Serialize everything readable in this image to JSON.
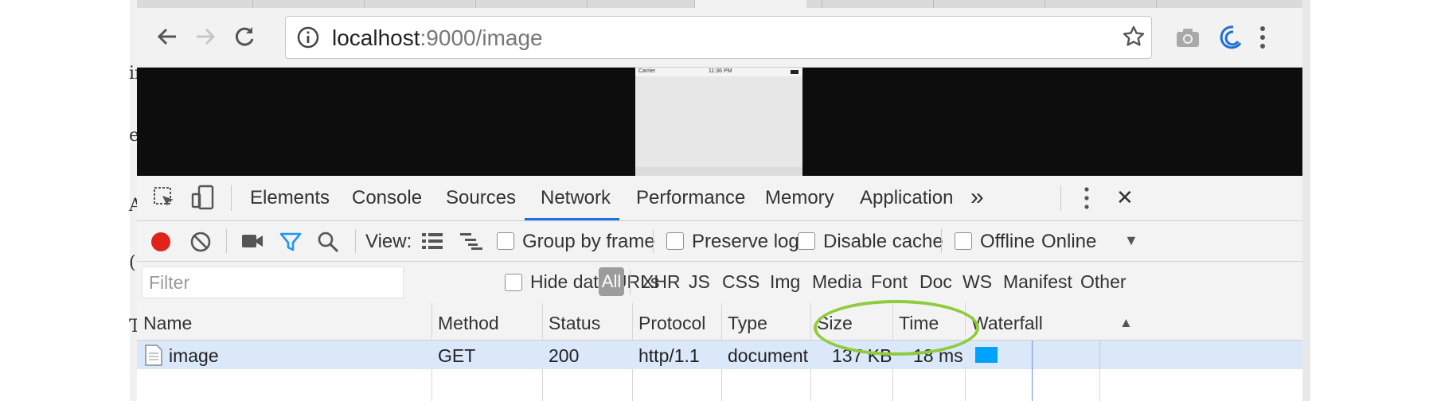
{
  "browser": {
    "url_host": "localhost",
    "url_path": ":9000/image",
    "nav": {
      "back": "back-arrow-icon",
      "forward": "forward-arrow-icon",
      "reload": "reload-icon"
    }
  },
  "phone": {
    "carrier": "Carrier",
    "time": "11:36 PM"
  },
  "behind_text": [
    "in",
    "e",
    "A",
    "(",
    "T"
  ],
  "devtools": {
    "tabs": [
      "Elements",
      "Console",
      "Sources",
      "Network",
      "Performance",
      "Memory",
      "Application"
    ],
    "active_tab": "Network",
    "more_label": "»",
    "close_label": "✕",
    "network": {
      "view_label": "View:",
      "group_by_frame": "Group by frame",
      "preserve_log": "Preserve log",
      "disable_cache": "Disable cache",
      "offline": "Offline",
      "throttle": "Online",
      "throttle_arrow": "▼"
    },
    "filter": {
      "placeholder": "Filter",
      "hide_data_urls": "Hide data URLs",
      "types": [
        "All",
        "XHR",
        "JS",
        "CSS",
        "Img",
        "Media",
        "Font",
        "Doc",
        "WS",
        "Manifest",
        "Other"
      ],
      "active_type": "All"
    },
    "table": {
      "headers": [
        "Name",
        "Method",
        "Status",
        "Protocol",
        "Type",
        "Size",
        "Time",
        "Waterfall"
      ],
      "sort_indicator": "▲",
      "rows": [
        {
          "name": "image",
          "method": "GET",
          "status": "200",
          "protocol": "http/1.1",
          "type": "document",
          "size": "137 KB",
          "time": "18 ms"
        }
      ]
    }
  },
  "colors": {
    "record": "#e2231a",
    "active_blue": "#1a73e8",
    "filter_active": "#2196f3",
    "row_selected": "#dbe8fa",
    "waterfall_bar": "#00a2ff",
    "highlight": "#8fcc3d"
  }
}
